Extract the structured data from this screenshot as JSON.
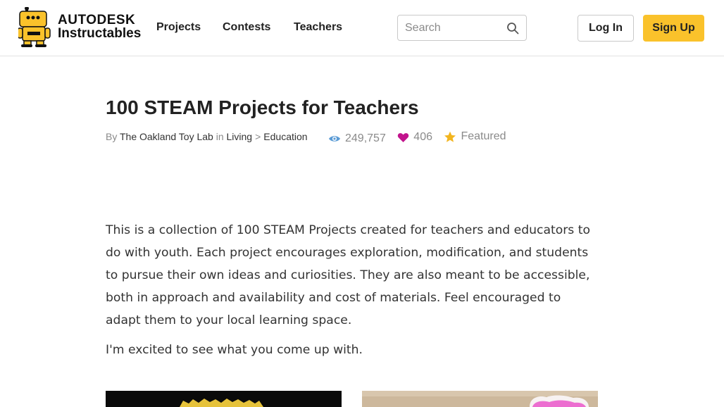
{
  "header": {
    "brand_line1": "AUTODESK",
    "brand_line2": "Instructables",
    "nav": [
      "Projects",
      "Contests",
      "Teachers"
    ],
    "search_placeholder": "Search",
    "login_label": "Log In",
    "signup_label": "Sign Up",
    "accent_color": "#fac22b"
  },
  "article": {
    "title": "100 STEAM Projects for Teachers",
    "by_label": "By",
    "author": "The Oakland Toy Lab",
    "in_label": "in",
    "category": "Living",
    "category_sep": ">",
    "subcategory": "Education",
    "views": "249,757",
    "favorites": "406",
    "featured_label": "Featured",
    "paragraph1": "This is a collection of 100 STEAM Projects created for teachers and educators to do with youth. Each project encourages exploration, modification, and students to pursue their own ideas and curiosities. They are also meant to be accessible, both in approach and availability and cost of materials. Feel encouraged to adapt them to your local learning space.",
    "paragraph2": "I'm excited to see what you come up with."
  },
  "icons": {
    "logo": "robot-mascot-icon",
    "search": "search-icon",
    "views": "eye-icon",
    "favorites": "heart-icon",
    "featured": "star-icon"
  },
  "colors": {
    "eye": "#5a9bd5",
    "heart": "#c2148d",
    "star": "#f2b51f"
  }
}
